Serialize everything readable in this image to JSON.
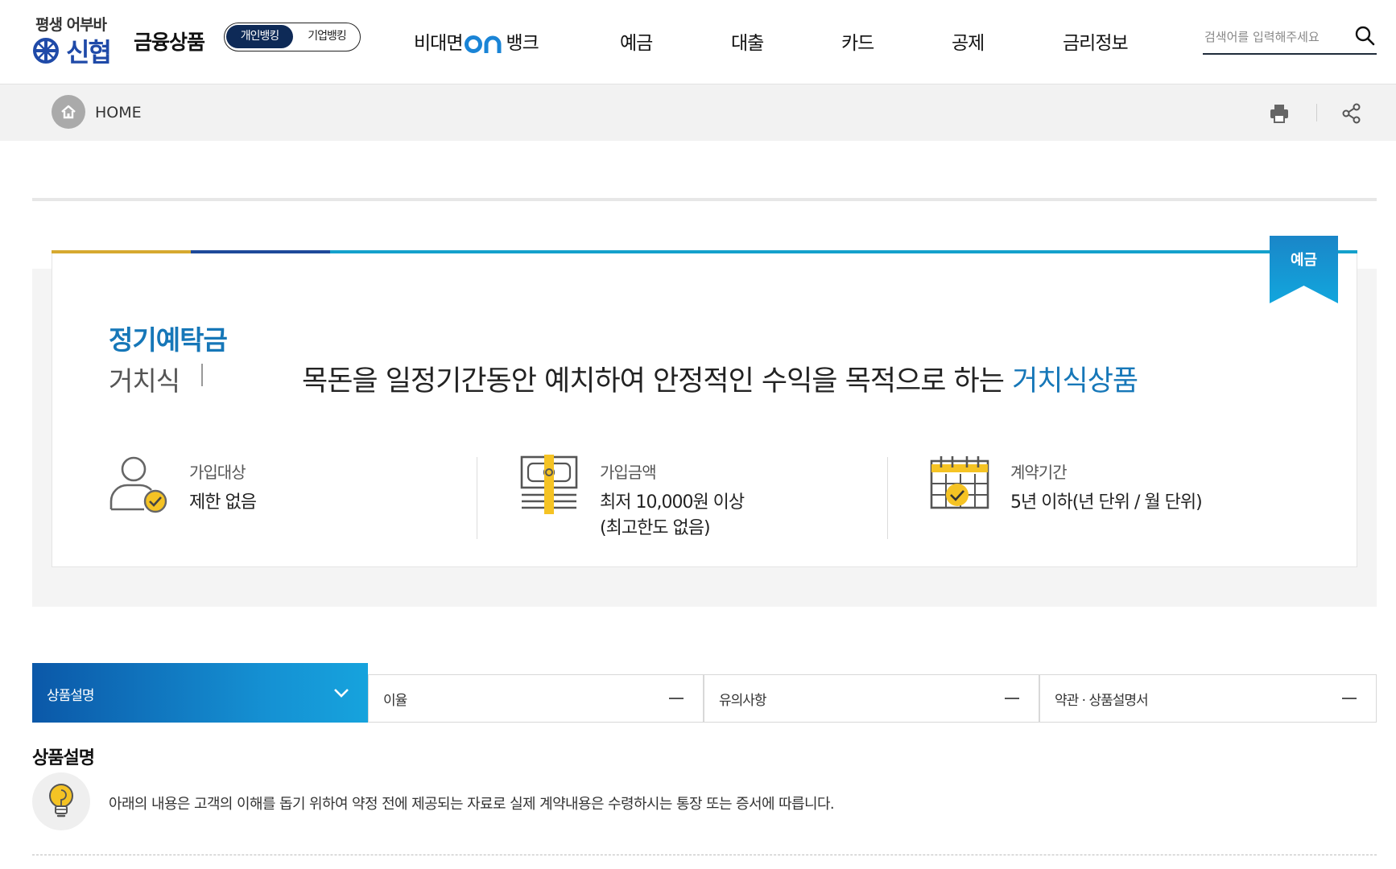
{
  "header": {
    "logo_tagline": "평생 어부바",
    "logo_name": "신협",
    "title": "금융상품",
    "bank_toggle": {
      "personal": "개인뱅킹",
      "corporate": "기업뱅킹"
    },
    "nav": [
      {
        "label_prefix": "비대면",
        "label_suffix": "뱅크",
        "logo": "on"
      },
      {
        "label": "예금"
      },
      {
        "label": "대출"
      },
      {
        "label": "카드"
      },
      {
        "label": "공제"
      },
      {
        "label": "금리정보"
      }
    ],
    "search": {
      "placeholder": "검색어를 입력해주세요",
      "value": "",
      "icon": "search-icon"
    }
  },
  "breadcrumb": {
    "home_label": "HOME",
    "icons": [
      "home-icon",
      "print-icon",
      "share-icon"
    ]
  },
  "product": {
    "ribbon": "예금",
    "name": "정기예탁금",
    "type": "거치식",
    "description": "목돈을 일정기간동안 예치하여 안정적인 수익을 목적으로 하는 ",
    "description_highlight": "거치식상품",
    "info": [
      {
        "icon": "user-check-icon",
        "label": "가입대상",
        "value": "제한 없음"
      },
      {
        "icon": "money-icon",
        "label": "가입금액",
        "value": "최저 10,000원 이상",
        "value2": "(최고한도 없음)"
      },
      {
        "icon": "calendar-check-icon",
        "label": "계약기간",
        "value": "5년 이하(년 단위 / 월 단위)"
      }
    ],
    "colors": {
      "gold": "#d6a92f",
      "navy": "#1e4a9a",
      "blue": "#14a1cc",
      "accent_text": "#1677b8"
    }
  },
  "tabs": [
    {
      "label": "상품설명",
      "active": true
    },
    {
      "label": "이율",
      "active": false
    },
    {
      "label": "유의사항",
      "active": false
    },
    {
      "label": "약관 · 상품설명서",
      "active": false
    }
  ],
  "section": {
    "title": "상품설명",
    "notice_icon": "lightbulb-icon",
    "notice": "아래의 내용은 고객의 이해를 돕기 위하여 약정 전에 제공되는 자료로 실제 계약내용은 수령하시는 통장 또는 증서에 따릅니다."
  }
}
